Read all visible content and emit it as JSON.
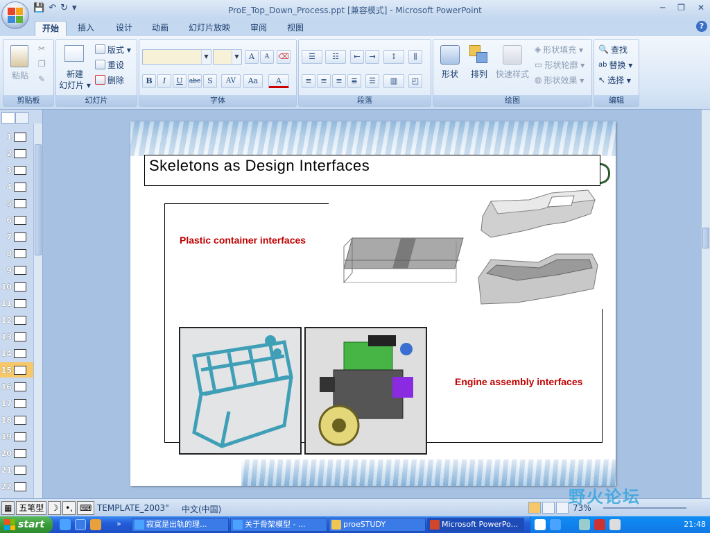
{
  "window": {
    "title": "ProE_Top_Down_Process.ppt [兼容模式] - Microsoft PowerPoint",
    "minimize": "─",
    "restore": "❐",
    "close": "✕"
  },
  "qat": {
    "save": "💾",
    "undo": "↶",
    "redo": "↻",
    "more": "▾"
  },
  "tabs": [
    {
      "label": "开始",
      "active": true
    },
    {
      "label": "插入"
    },
    {
      "label": "设计"
    },
    {
      "label": "动画"
    },
    {
      "label": "幻灯片放映"
    },
    {
      "label": "审阅"
    },
    {
      "label": "视图"
    }
  ],
  "help": "?",
  "ribbon": {
    "clipboard": {
      "label": "剪贴板",
      "paste": "粘贴"
    },
    "slides": {
      "label": "幻灯片",
      "new_slide": "新建",
      "new_slide2": "幻灯片 ▾",
      "layout": "版式 ▾",
      "reset": "重设",
      "delete": "删除"
    },
    "font": {
      "label": "字体",
      "bold": "B",
      "italic": "I",
      "underline": "U",
      "strike": "abc",
      "shadow": "S",
      "spacing": "AV",
      "case": "Aa",
      "color": "A",
      "grow": "A",
      "shrink": "A"
    },
    "paragraph": {
      "label": "段落"
    },
    "drawing": {
      "label": "绘图",
      "shapes": "形状",
      "arrange": "排列",
      "quick_styles": "快速样式",
      "fill": "形状填充 ▾",
      "outline": "形状轮廓 ▾",
      "effects": "形状效果 ▾"
    },
    "editing": {
      "label": "编辑",
      "find": "查找",
      "replace": "替换 ▾",
      "select": "选择 ▾"
    }
  },
  "slides_panel": {
    "items": [
      "1",
      "2",
      "3",
      "4",
      "5",
      "6",
      "7",
      "8",
      "9",
      "10",
      "11",
      "12",
      "13",
      "14",
      "15",
      "16",
      "17",
      "18",
      "19",
      "20",
      "21",
      "22"
    ],
    "active": "15"
  },
  "slide": {
    "title": "Skeletons as Design Interfaces",
    "label_plastic": "Plastic container interfaces",
    "label_engine": "Engine assembly interfaces"
  },
  "status": {
    "ime": [
      "五笔型",
      "☽",
      "•,",
      "⌨"
    ],
    "template": "TEMPLATE_2003\"",
    "language": "中文(中国)",
    "zoom": "73%",
    "watermark": "野火论坛"
  },
  "taskbar": {
    "start": "start",
    "tasks": [
      "寂寞是出轨的理...",
      "关于骨架模型 - ...",
      "proeSTUDY",
      "Microsoft PowerPo..."
    ],
    "clock": "21:48"
  }
}
